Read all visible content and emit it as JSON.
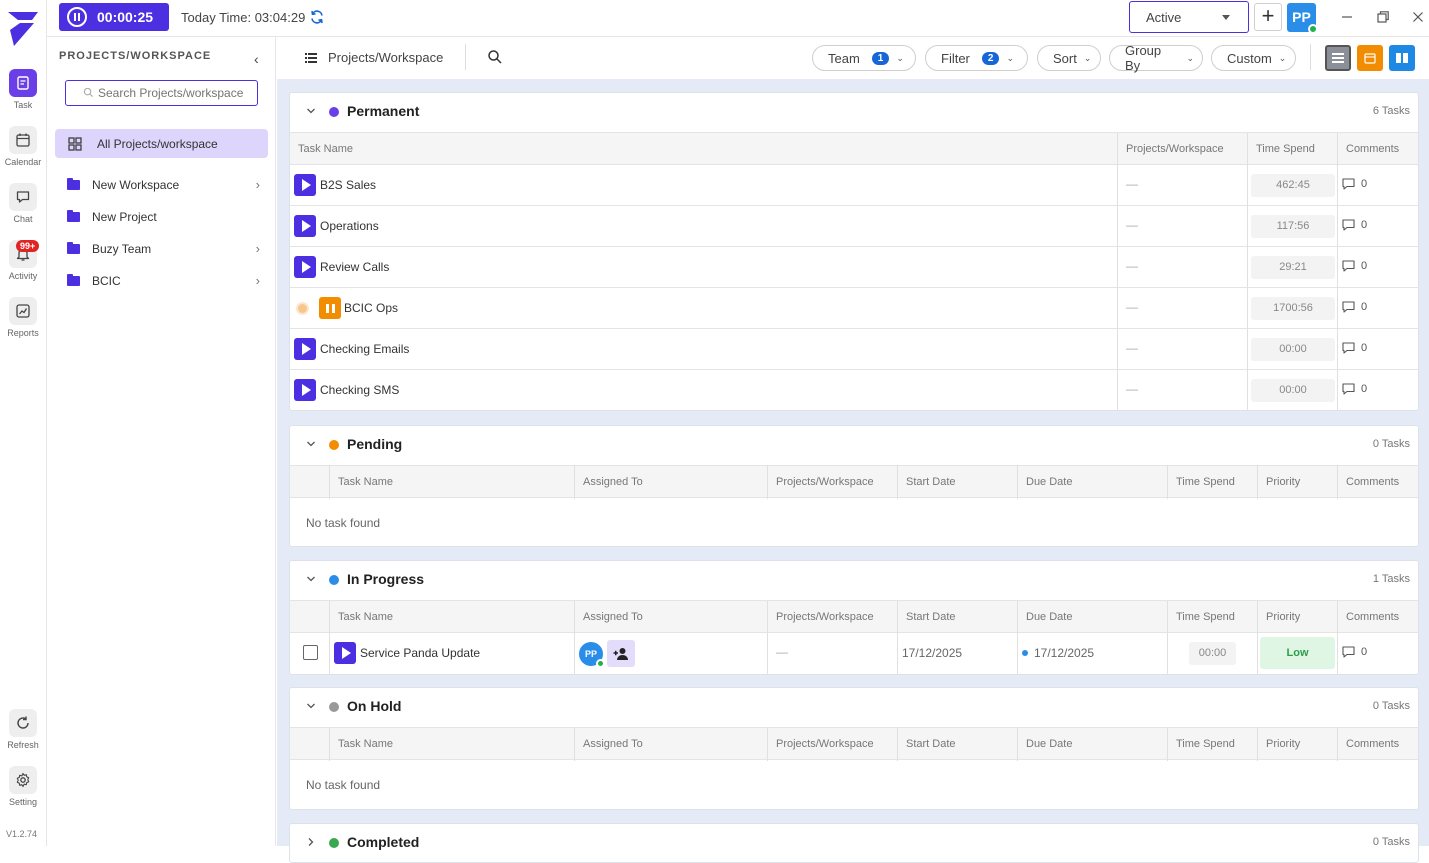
{
  "topbar": {
    "timer": "00:00:25",
    "today_time": "Today Time: 03:04:29",
    "status": "Active",
    "user_initials": "PP"
  },
  "rail": {
    "items": [
      {
        "label": "Task"
      },
      {
        "label": "Calendar"
      },
      {
        "label": "Chat"
      },
      {
        "label": "Activity",
        "badge": "99+"
      },
      {
        "label": "Reports"
      },
      {
        "label": "Refresh"
      },
      {
        "label": "Setting"
      }
    ],
    "version": "V1.2.74"
  },
  "sidebar": {
    "title": "PROJECTS/WORKSPACE",
    "search_placeholder": "Search Projects/workspace",
    "all_projects": "All Projects/workspace",
    "folders": [
      {
        "label": "New Workspace",
        "has_children": true
      },
      {
        "label": "New Project",
        "has_children": false
      },
      {
        "label": "Buzy Team",
        "has_children": true
      },
      {
        "label": "BCIC",
        "has_children": true
      }
    ]
  },
  "main": {
    "title": "Projects/Workspace",
    "filters": {
      "team": "Team",
      "team_count": "1",
      "filter": "Filter",
      "filter_count": "2",
      "sort": "Sort",
      "group_by": "Group By",
      "custom": "Custom"
    },
    "columns_full": [
      "Task Name",
      "Assigned To",
      "Projects/Workspace",
      "Start Date",
      "Due Date",
      "Time Spend",
      "Priority",
      "Comments"
    ],
    "columns_permanent": [
      "Task Name",
      "Projects/Workspace",
      "Time Spend",
      "Comments"
    ],
    "empty_text": "No task found",
    "groups": [
      {
        "title": "Permanent",
        "count": "6 Tasks",
        "color": "#6b3fe8",
        "tasks": [
          {
            "name": "B2S Sales",
            "project": "—",
            "time": "462:45",
            "comments": "0",
            "running": false
          },
          {
            "name": "Operations",
            "project": "—",
            "time": "117:56",
            "comments": "0",
            "running": false
          },
          {
            "name": "Review Calls",
            "project": "—",
            "time": "29:21",
            "comments": "0",
            "running": false
          },
          {
            "name": "BCIC Ops",
            "project": "—",
            "time": "1700:56",
            "comments": "0",
            "running": true
          },
          {
            "name": "Checking Emails",
            "project": "—",
            "time": "00:00",
            "comments": "0",
            "running": false
          },
          {
            "name": "Checking SMS",
            "project": "—",
            "time": "00:00",
            "comments": "0",
            "running": false
          }
        ]
      },
      {
        "title": "Pending",
        "count": "0 Tasks",
        "color": "#f28c00"
      },
      {
        "title": "In Progress",
        "count": "1 Tasks",
        "color": "#2a8de8",
        "task": {
          "name": "Service Panda Update",
          "assignee": "PP",
          "project": "—",
          "start": "17/12/2025",
          "due": "17/12/2025",
          "time": "00:00",
          "priority": "Low",
          "comments": "0"
        }
      },
      {
        "title": "On Hold",
        "count": "0 Tasks",
        "color": "#999999"
      },
      {
        "title": "Completed",
        "count": "0 Tasks",
        "color": "#3aa853"
      }
    ]
  },
  "colors": {
    "brand": "#4b2fe0",
    "accent_orange": "#f28c00",
    "accent_blue": "#2a8de8"
  }
}
